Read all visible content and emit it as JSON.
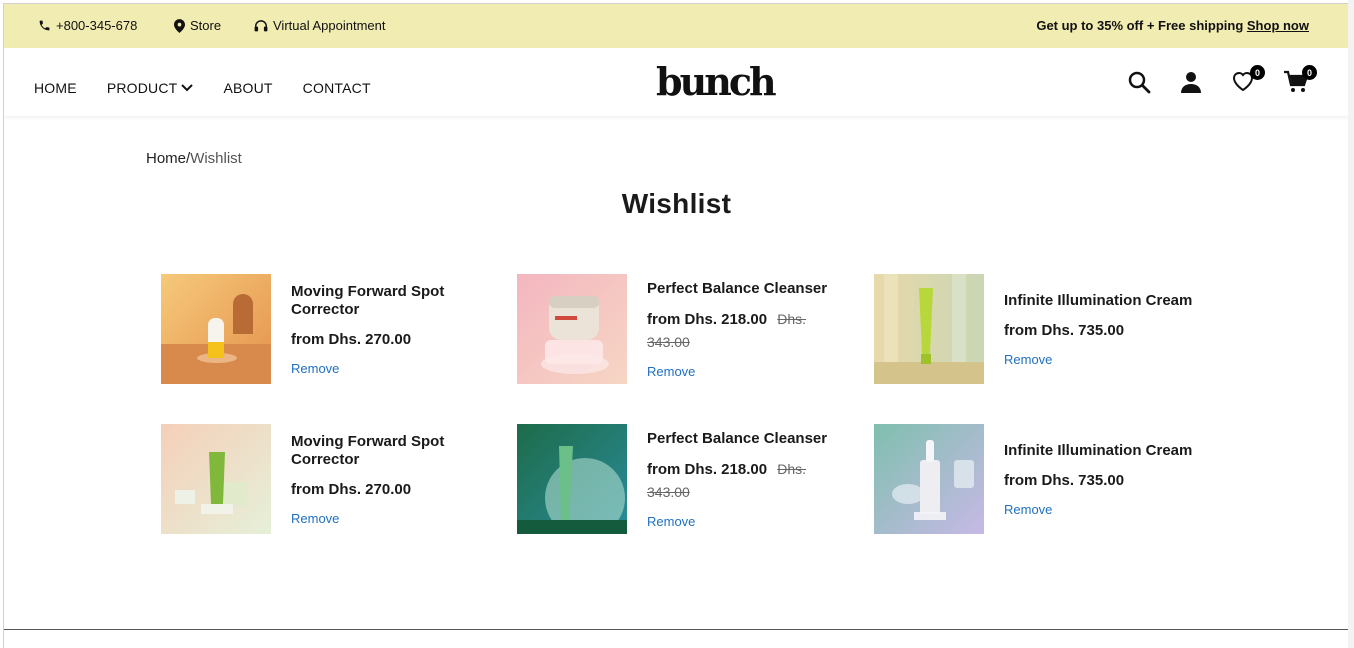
{
  "topbar": {
    "phone": "+800-345-678",
    "store": "Store",
    "appointment": "Virtual Appointment",
    "promo_text": "Get up to 35% off + Free shipping",
    "promo_link": "Shop now"
  },
  "nav": {
    "home": "HOME",
    "product": "PRODUCT",
    "about": "ABOUT",
    "contact": "CONTACT",
    "logo": "bunch",
    "wishlist_count": "0",
    "cart_count": "0"
  },
  "breadcrumb": {
    "home": "Home",
    "separator": "/",
    "current": "Wishlist"
  },
  "page_title": "Wishlist",
  "items": [
    {
      "name": "Moving Forward Spot Corrector",
      "price": "from Dhs. 270.00",
      "old_price": "",
      "remove": "Remove",
      "image": "product-tube-orange"
    },
    {
      "name": "Perfect Balance Cleanser",
      "price": "from Dhs. 218.00",
      "old_price": "Dhs. 343.00",
      "remove": "Remove",
      "image": "product-jar-pink"
    },
    {
      "name": "Infinite Illumination Cream",
      "price": "from Dhs. 735.00",
      "old_price": "",
      "remove": "Remove",
      "image": "product-tube-lime"
    },
    {
      "name": "Moving Forward Spot Corrector",
      "price": "from Dhs. 270.00",
      "old_price": "",
      "remove": "Remove",
      "image": "product-tube-green-pastel"
    },
    {
      "name": "Perfect Balance Cleanser",
      "price": "from Dhs. 218.00",
      "old_price": "Dhs. 343.00",
      "remove": "Remove",
      "image": "product-tube-green-dark"
    },
    {
      "name": "Infinite Illumination Cream",
      "price": "from Dhs. 735.00",
      "old_price": "",
      "remove": "Remove",
      "image": "product-serum-dropper"
    }
  ],
  "colors": {
    "topbar_bg": "#f1ecb1",
    "link_blue": "#1f70c1"
  }
}
